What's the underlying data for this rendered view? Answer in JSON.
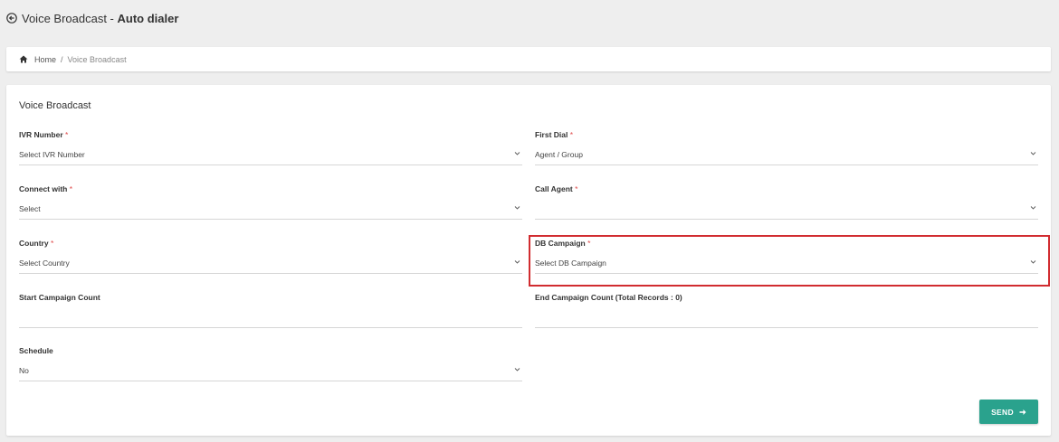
{
  "header": {
    "title_prefix": "Voice Broadcast - ",
    "title_strong": "Auto dialer"
  },
  "breadcrumb": {
    "home": "Home",
    "separator": "/",
    "current": "Voice Broadcast"
  },
  "form": {
    "title": "Voice Broadcast",
    "required_marker": "*",
    "ivr_number": {
      "label": "IVR Number",
      "value": "Select IVR Number"
    },
    "first_dial": {
      "label": "First Dial",
      "value": "Agent / Group"
    },
    "connect_with": {
      "label": "Connect with",
      "value": "Select"
    },
    "call_agent": {
      "label": "Call Agent",
      "value": ""
    },
    "country": {
      "label": "Country",
      "value": "Select Country"
    },
    "db_campaign": {
      "label": "DB Campaign",
      "value": "Select DB Campaign"
    },
    "start_campaign_count": {
      "label": "Start Campaign Count",
      "value": ""
    },
    "end_campaign_count": {
      "label": "End Campaign Count (Total Records : 0)",
      "value": ""
    },
    "schedule": {
      "label": "Schedule",
      "value": "No"
    },
    "send_label": "SEND"
  },
  "colors": {
    "accent": "#2aa28d",
    "required": "#e04b4b",
    "highlight": "#d12c30"
  }
}
